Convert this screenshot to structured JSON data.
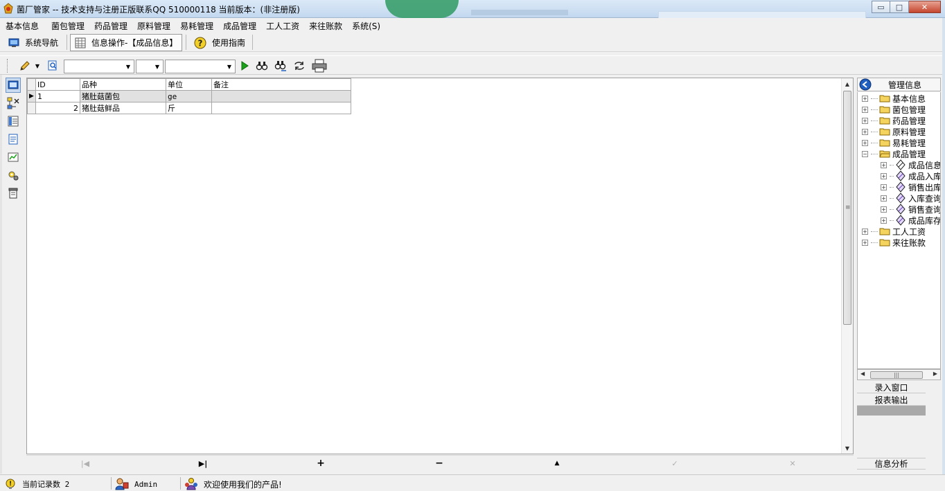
{
  "window": {
    "title": "菌厂管家 -- 技术支持与注册正版联系QQ 510000118   当前版本：(非注册版)",
    "minimize_glyph": "▭",
    "maximize_glyph": "□",
    "close_glyph": "✕"
  },
  "menu": [
    "基本信息",
    "菌包管理",
    "药品管理",
    "原料管理",
    "易耗管理",
    "成品管理",
    "工人工资",
    "来往账款",
    "系统(S)"
  ],
  "tabs": {
    "nav": "系统导航",
    "info": "信息操作-【成品信息】",
    "guide": "使用指南"
  },
  "toolbar": {
    "field_combo": "",
    "operator_combo": "",
    "value_combo": ""
  },
  "grid": {
    "columns": [
      "ID",
      "品种",
      "单位",
      "备注"
    ],
    "rows": [
      {
        "id": "1",
        "name": "猪肚菇菌包",
        "unit": "ge",
        "note": ""
      },
      {
        "id": "2",
        "name": "猪肚菇鲜品",
        "unit": "斤",
        "note": ""
      }
    ],
    "selected_row": 0
  },
  "navigator": {
    "first": "|◀",
    "last": "▶|",
    "insert": "+",
    "delete": "−",
    "edit": "▲",
    "post": "✓",
    "cancel": "✕"
  },
  "side_panel": {
    "title": "管理信息",
    "tree": [
      {
        "label": "基本信息",
        "expander": "+",
        "level": 0,
        "type": "folder"
      },
      {
        "label": "菌包管理",
        "expander": "+",
        "level": 0,
        "type": "folder"
      },
      {
        "label": "药品管理",
        "expander": "+",
        "level": 0,
        "type": "folder"
      },
      {
        "label": "原料管理",
        "expander": "+",
        "level": 0,
        "type": "folder"
      },
      {
        "label": "易耗管理",
        "expander": "+",
        "level": 0,
        "type": "folder"
      },
      {
        "label": "成品管理",
        "expander": "−",
        "level": 0,
        "type": "folder"
      },
      {
        "label": "成品信息",
        "expander": "+",
        "level": 1,
        "type": "item"
      },
      {
        "label": "成品入库",
        "expander": "+",
        "level": 1,
        "type": "item"
      },
      {
        "label": "销售出库",
        "expander": "+",
        "level": 1,
        "type": "item"
      },
      {
        "label": "入库查询",
        "expander": "+",
        "level": 1,
        "type": "item"
      },
      {
        "label": "销售查询",
        "expander": "+",
        "level": 1,
        "type": "item"
      },
      {
        "label": "成品库存",
        "expander": "+",
        "level": 1,
        "type": "item"
      },
      {
        "label": "工人工资",
        "expander": "+",
        "level": 0,
        "type": "folder"
      },
      {
        "label": "来往账款",
        "expander": "+",
        "level": 0,
        "type": "folder"
      }
    ],
    "hscroll_grip": "|||",
    "buttons": {
      "entry": "录入窗口",
      "report": "报表输出",
      "analysis": "信息分析"
    }
  },
  "status": {
    "record_count": "当前记录数 2",
    "user": "Admin",
    "welcome": "欢迎使用我们的产品!"
  },
  "colors": {
    "titlebar": "#c3d8ef",
    "accent_blue": "#1f5fbf",
    "run_green": "#1ba21b",
    "folder_yellow": "#f4d35e"
  },
  "icons": {
    "scroll_up": "▲",
    "scroll_down": "▼",
    "scroll_left": "◀",
    "scroll_right": "▶",
    "scroll_grip": "≡",
    "dropdown_arrow": "▼",
    "row_indicator": "▶"
  }
}
